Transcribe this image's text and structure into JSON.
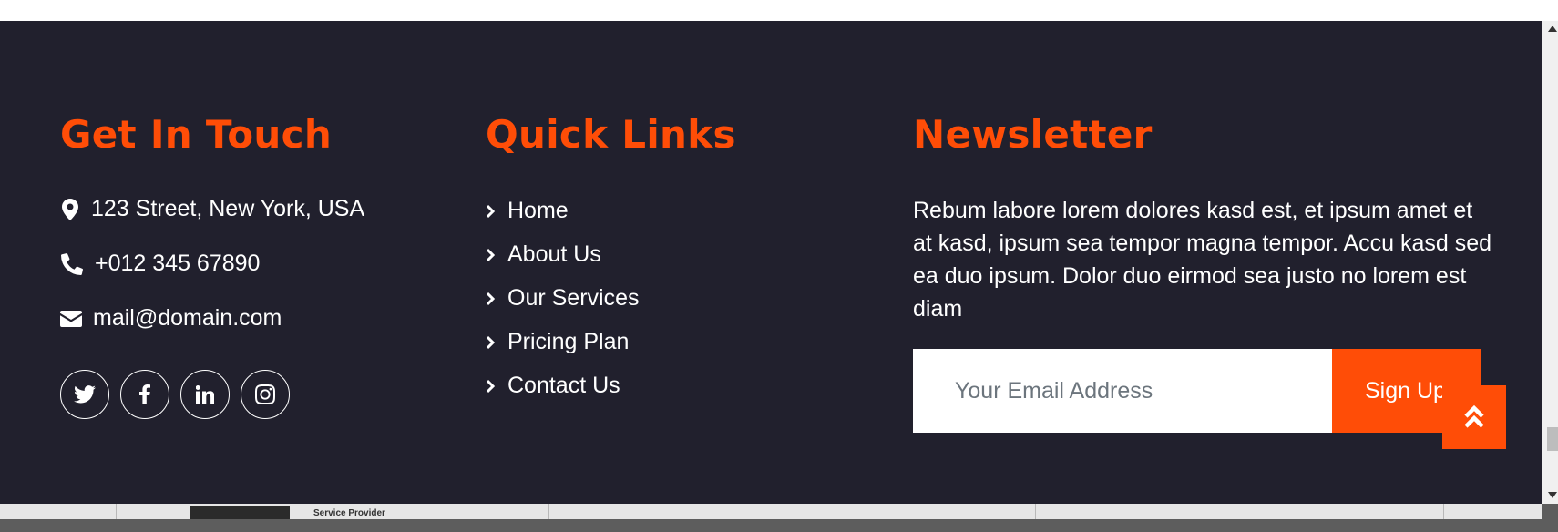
{
  "contact": {
    "title": "Get In Touch",
    "address": "123 Street, New York, USA",
    "phone": "+012 345 67890",
    "email": "mail@domain.com",
    "social": [
      "twitter-icon",
      "facebook-icon",
      "linkedin-icon",
      "instagram-icon"
    ]
  },
  "links": {
    "title": "Quick Links",
    "items": [
      "Home",
      "About Us",
      "Our Services",
      "Pricing Plan",
      "Contact Us"
    ]
  },
  "newsletter": {
    "title": "Newsletter",
    "text": "Rebum labore lorem dolores kasd est, et ipsum amet et at kasd, ipsum sea tempor magna tempor. Accu kasd sed ea duo ipsum. Dolor duo eirmod sea justo no lorem est diam",
    "placeholder": "Your Email Address",
    "button": "Sign Up"
  },
  "peek": {
    "caption": "Service Provider"
  },
  "colors": {
    "accent": "#ff4d07",
    "background": "#21202d"
  }
}
